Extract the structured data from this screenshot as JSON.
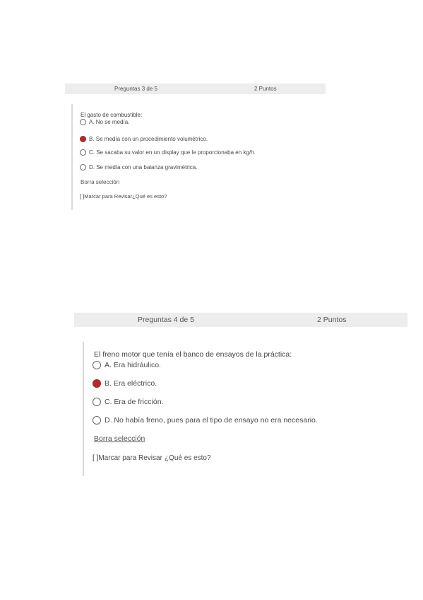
{
  "questions": [
    {
      "header_number": "Preguntas 3 de 5",
      "header_points": "2 Puntos",
      "text": "El gasto de combustible:",
      "options": [
        {
          "label": "A. No se medía.",
          "selected": false
        },
        {
          "label": "B. Se medía con un procedimiento volumétrico.",
          "selected": true
        },
        {
          "label": "C. Se sacaba su valor en un display que le proporcionaba en kg/h.",
          "selected": false
        },
        {
          "label": "D. Se medía con una balanza gravimétrica.",
          "selected": false
        }
      ],
      "clear_label": "Borra selección",
      "mark_label": "Marcar para Revisar",
      "help_label": "¿Qué es esto?"
    },
    {
      "header_number": "Preguntas 4 de 5",
      "header_points": "2 Puntos",
      "text": "El freno motor que tenía el banco de ensayos de la práctica:",
      "options": [
        {
          "label": "A. Era hidráulico.",
          "selected": false
        },
        {
          "label": "B. Era eléctrico.",
          "selected": true
        },
        {
          "label": "C. Era de fricción.",
          "selected": false
        },
        {
          "label": "D. No había freno, pues para el tipo de ensayo no era necesario.",
          "selected": false
        }
      ],
      "clear_label": "Borra selección",
      "mark_label": "Marcar para Revisar",
      "help_label": "¿Qué es esto?"
    }
  ],
  "colors": {
    "selected_radio": "#b22a2a",
    "header_bg": "#ededed"
  }
}
